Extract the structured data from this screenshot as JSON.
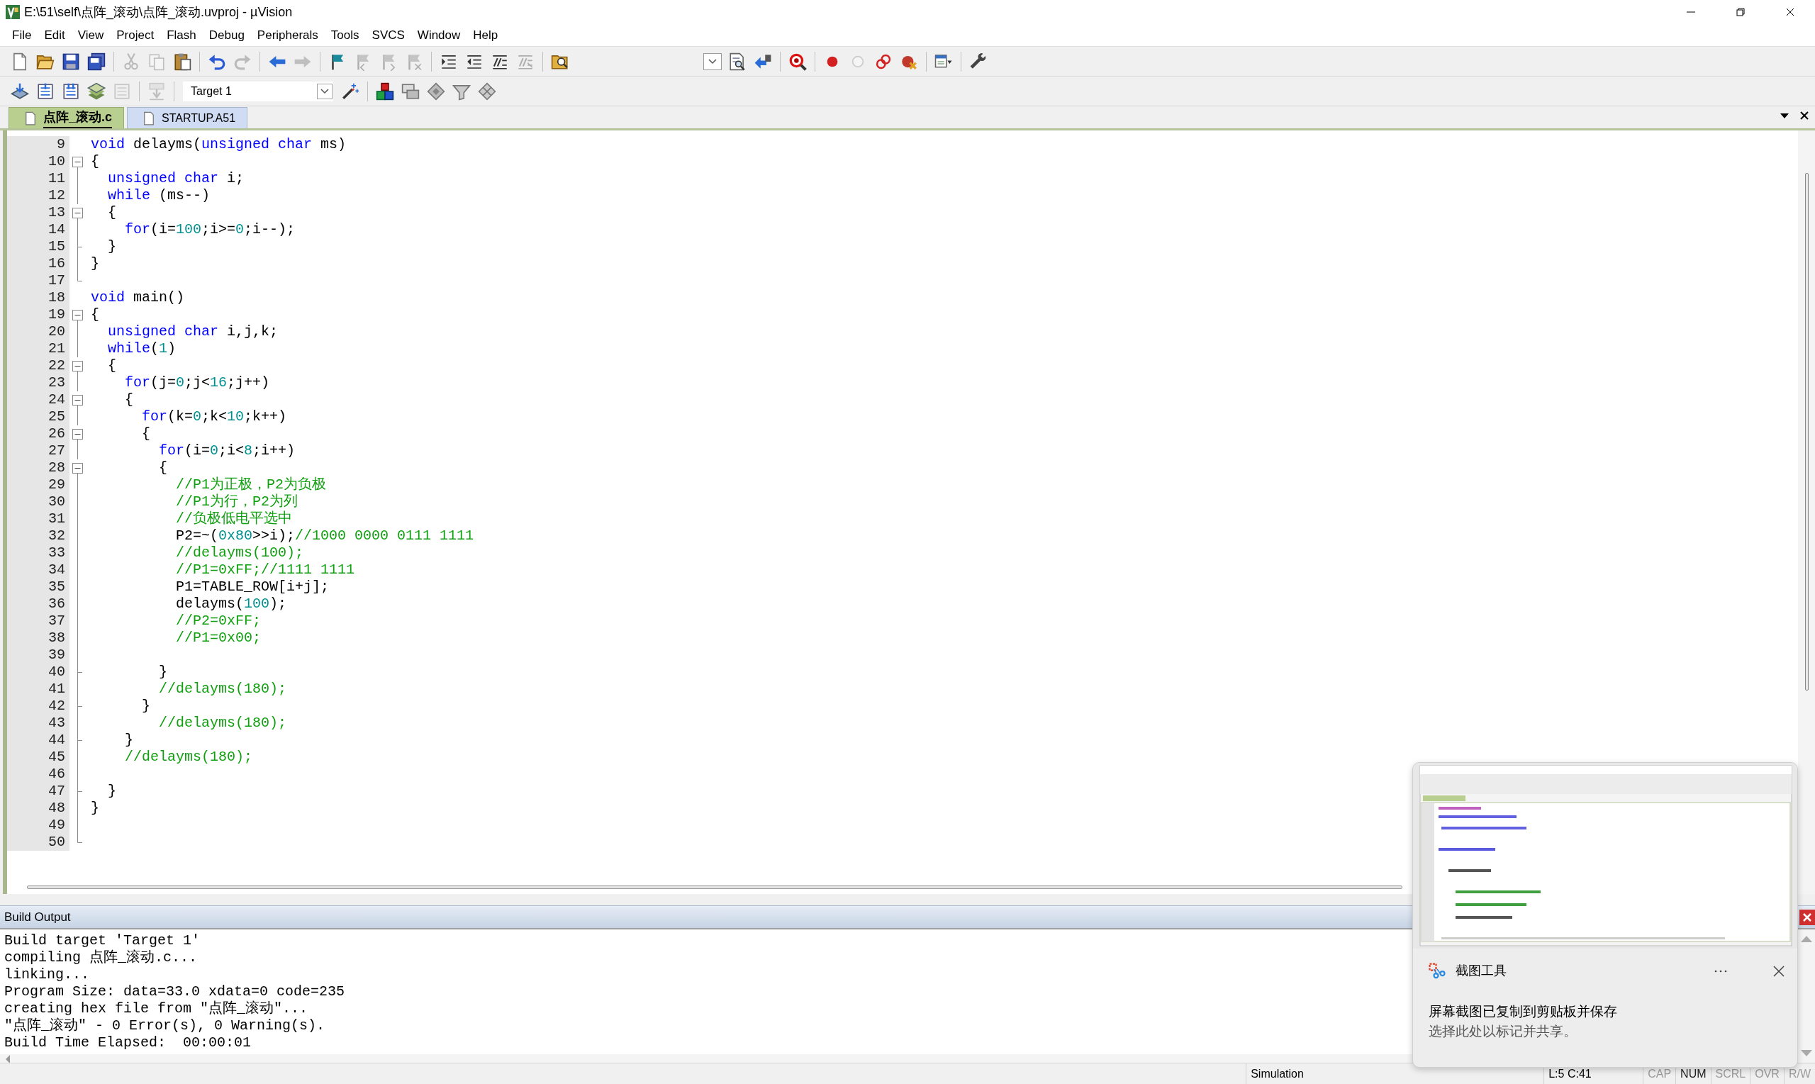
{
  "window": {
    "title": "E:\\51\\self\\点阵_滚动\\点阵_滚动.uvproj - µVision"
  },
  "menu": [
    "File",
    "Edit",
    "View",
    "Project",
    "Flash",
    "Debug",
    "Peripherals",
    "Tools",
    "SVCS",
    "Window",
    "Help"
  ],
  "toolbar_1": [
    {
      "kind": "new",
      "disabled": false
    },
    {
      "kind": "open",
      "disabled": false
    },
    {
      "kind": "save",
      "disabled": false
    },
    {
      "kind": "saveall",
      "disabled": false
    },
    {
      "kind": "separator"
    },
    {
      "kind": "cut",
      "disabled": true
    },
    {
      "kind": "copy",
      "disabled": true
    },
    {
      "kind": "paste",
      "disabled": false
    },
    {
      "kind": "separator"
    },
    {
      "kind": "undo",
      "disabled": false
    },
    {
      "kind": "redo",
      "disabled": true
    },
    {
      "kind": "separator"
    },
    {
      "kind": "back",
      "disabled": false
    },
    {
      "kind": "forward",
      "disabled": true
    },
    {
      "kind": "separator"
    },
    {
      "kind": "flag",
      "disabled": false
    },
    {
      "kind": "flagprev",
      "disabled": true
    },
    {
      "kind": "flagnext",
      "disabled": true
    },
    {
      "kind": "flagclear",
      "disabled": true
    },
    {
      "kind": "separator"
    },
    {
      "kind": "indent",
      "disabled": false
    },
    {
      "kind": "outdent",
      "disabled": false
    },
    {
      "kind": "comment",
      "disabled": false
    },
    {
      "kind": "uncomment",
      "disabled": true
    },
    {
      "kind": "separator"
    },
    {
      "kind": "findfiles",
      "disabled": false
    },
    {
      "kind": "spacer"
    },
    {
      "kind": "combo",
      "disabled": false
    },
    {
      "kind": "find",
      "disabled": false
    },
    {
      "kind": "findarrow",
      "disabled": false
    },
    {
      "kind": "separator"
    },
    {
      "kind": "debug",
      "disabled": false
    },
    {
      "kind": "separator"
    },
    {
      "kind": "breakpoint",
      "disabled": false
    },
    {
      "kind": "circle",
      "disabled": true
    },
    {
      "kind": "rings",
      "disabled": false
    },
    {
      "kind": "bpkill",
      "disabled": false
    },
    {
      "kind": "separator"
    },
    {
      "kind": "window",
      "disabled": false
    },
    {
      "kind": "separator"
    },
    {
      "kind": "wrench",
      "disabled": false
    }
  ],
  "toolbar_2": [
    {
      "kind": "translate",
      "disabled": false
    },
    {
      "kind": "build",
      "disabled": false
    },
    {
      "kind": "rebuild",
      "disabled": false
    },
    {
      "kind": "batch",
      "disabled": false
    },
    {
      "kind": "stop",
      "disabled": true
    },
    {
      "kind": "separator"
    },
    {
      "kind": "load",
      "disabled": true
    },
    {
      "kind": "separator"
    },
    {
      "kind": "target",
      "value": "Target 1"
    },
    {
      "kind": "wand",
      "disabled": false
    },
    {
      "kind": "separator"
    },
    {
      "kind": "components",
      "disabled": false
    },
    {
      "kind": "stack",
      "disabled": false
    },
    {
      "kind": "diamond",
      "disabled": false
    },
    {
      "kind": "funnel",
      "disabled": false
    },
    {
      "kind": "grid",
      "disabled": false
    }
  ],
  "tabs": [
    {
      "label": "点阵_滚动.c",
      "selected": true
    },
    {
      "label": "STARTUP.A51",
      "selected": false
    }
  ],
  "editor": {
    "lines": [
      {
        "number": "9",
        "kind": "plain",
        "tokens": [
          {
            "kind": "keyword",
            "text": "void"
          },
          {
            "kind": "plain",
            "text": " delayms("
          },
          {
            "kind": "keyword",
            "text": "unsigned char"
          },
          {
            "kind": "plain",
            "text": " ms)"
          }
        ]
      },
      {
        "number": "10",
        "kind": "box",
        "tokens": [
          {
            "kind": "plain",
            "text": "{"
          }
        ]
      },
      {
        "number": "11",
        "kind": "line",
        "tokens": [
          {
            "kind": "keyword",
            "text": "  unsigned char"
          },
          {
            "kind": "plain",
            "text": " i;"
          }
        ]
      },
      {
        "number": "12",
        "kind": "line",
        "tokens": [
          {
            "kind": "keyword",
            "text": "  while"
          },
          {
            "kind": "plain",
            "text": " (ms--)"
          }
        ]
      },
      {
        "number": "13",
        "kind": "box",
        "tokens": [
          {
            "kind": "plain",
            "text": "  {"
          }
        ]
      },
      {
        "number": "14",
        "kind": "line",
        "tokens": [
          {
            "kind": "keyword",
            "text": "    for"
          },
          {
            "kind": "plain",
            "text": "(i="
          },
          {
            "kind": "number",
            "text": "100"
          },
          {
            "kind": "plain",
            "text": ";i>="
          },
          {
            "kind": "number",
            "text": "0"
          },
          {
            "kind": "plain",
            "text": ";i--);"
          }
        ]
      },
      {
        "number": "15",
        "kind": "tick",
        "tokens": [
          {
            "kind": "plain",
            "text": "  }"
          }
        ]
      },
      {
        "number": "16",
        "kind": "line",
        "tokens": [
          {
            "kind": "plain",
            "text": "}"
          }
        ]
      },
      {
        "number": "17",
        "kind": "end"
      },
      {
        "number": "18",
        "kind": "plain",
        "tokens": [
          {
            "kind": "keyword",
            "text": "void"
          },
          {
            "kind": "plain",
            "text": " main()"
          }
        ]
      },
      {
        "number": "19",
        "kind": "box",
        "tokens": [
          {
            "kind": "plain",
            "text": "{"
          }
        ]
      },
      {
        "number": "20",
        "kind": "line",
        "tokens": [
          {
            "kind": "keyword",
            "text": "  unsigned char"
          },
          {
            "kind": "plain",
            "text": " i,j,k;"
          }
        ]
      },
      {
        "number": "21",
        "kind": "line",
        "tokens": [
          {
            "kind": "keyword",
            "text": "  while"
          },
          {
            "kind": "plain",
            "text": "("
          },
          {
            "kind": "number",
            "text": "1"
          },
          {
            "kind": "plain",
            "text": ")"
          }
        ]
      },
      {
        "number": "22",
        "kind": "box",
        "tokens": [
          {
            "kind": "plain",
            "text": "  {"
          }
        ]
      },
      {
        "number": "23",
        "kind": "line",
        "tokens": [
          {
            "kind": "keyword",
            "text": "    for"
          },
          {
            "kind": "plain",
            "text": "(j="
          },
          {
            "kind": "number",
            "text": "0"
          },
          {
            "kind": "plain",
            "text": ";j<"
          },
          {
            "kind": "number",
            "text": "16"
          },
          {
            "kind": "plain",
            "text": ";j++)"
          }
        ]
      },
      {
        "number": "24",
        "kind": "box",
        "tokens": [
          {
            "kind": "plain",
            "text": "    {"
          }
        ]
      },
      {
        "number": "25",
        "kind": "line",
        "tokens": [
          {
            "kind": "keyword",
            "text": "      for"
          },
          {
            "kind": "plain",
            "text": "(k="
          },
          {
            "kind": "number",
            "text": "0"
          },
          {
            "kind": "plain",
            "text": ";k<"
          },
          {
            "kind": "number",
            "text": "10"
          },
          {
            "kind": "plain",
            "text": ";k++)"
          }
        ]
      },
      {
        "number": "26",
        "kind": "box",
        "tokens": [
          {
            "kind": "plain",
            "text": "      {"
          }
        ]
      },
      {
        "number": "27",
        "kind": "line",
        "tokens": [
          {
            "kind": "keyword",
            "text": "        for"
          },
          {
            "kind": "plain",
            "text": "(i="
          },
          {
            "kind": "number",
            "text": "0"
          },
          {
            "kind": "plain",
            "text": ";i<"
          },
          {
            "kind": "number",
            "text": "8"
          },
          {
            "kind": "plain",
            "text": ";i++)"
          }
        ]
      },
      {
        "number": "28",
        "kind": "box",
        "tokens": [
          {
            "kind": "plain",
            "text": "        {"
          }
        ]
      },
      {
        "number": "29",
        "kind": "line",
        "tokens": [
          {
            "kind": "comment",
            "text": "          //P1为正极，P2为负极"
          }
        ]
      },
      {
        "number": "30",
        "kind": "line",
        "tokens": [
          {
            "kind": "comment",
            "text": "          //P1为行，P2为列"
          }
        ]
      },
      {
        "number": "31",
        "kind": "line",
        "tokens": [
          {
            "kind": "comment",
            "text": "          //负极低电平选中"
          }
        ]
      },
      {
        "number": "32",
        "kind": "line",
        "tokens": [
          {
            "kind": "plain",
            "text": "          P2=~("
          },
          {
            "kind": "number",
            "text": "0x80"
          },
          {
            "kind": "plain",
            "text": ">>i);"
          },
          {
            "kind": "comment",
            "text": "//1000 0000 0111 1111"
          }
        ]
      },
      {
        "number": "33",
        "kind": "line",
        "tokens": [
          {
            "kind": "comment",
            "text": "          //delayms(100);"
          }
        ]
      },
      {
        "number": "34",
        "kind": "line",
        "tokens": [
          {
            "kind": "comment",
            "text": "          //P1=0xFF;//1111 1111"
          }
        ]
      },
      {
        "number": "35",
        "kind": "line",
        "tokens": [
          {
            "kind": "plain",
            "text": "          P1=TABLE_ROW[i+j];"
          }
        ]
      },
      {
        "number": "36",
        "kind": "line",
        "tokens": [
          {
            "kind": "plain",
            "text": "          delayms("
          },
          {
            "kind": "number",
            "text": "100"
          },
          {
            "kind": "plain",
            "text": ");"
          }
        ]
      },
      {
        "number": "37",
        "kind": "line",
        "tokens": [
          {
            "kind": "comment",
            "text": "          //P2=0xFF;"
          }
        ]
      },
      {
        "number": "38",
        "kind": "line",
        "tokens": [
          {
            "kind": "comment",
            "text": "          //P1=0x00;"
          }
        ]
      },
      {
        "number": "39",
        "kind": "line"
      },
      {
        "number": "40",
        "kind": "tick",
        "tokens": [
          {
            "kind": "plain",
            "text": "        }"
          }
        ]
      },
      {
        "number": "41",
        "kind": "line",
        "tokens": [
          {
            "kind": "comment",
            "text": "        //delayms(180);"
          }
        ]
      },
      {
        "number": "42",
        "kind": "tick",
        "tokens": [
          {
            "kind": "plain",
            "text": "      }"
          }
        ]
      },
      {
        "number": "43",
        "kind": "line",
        "tokens": [
          {
            "kind": "comment",
            "text": "        //delayms(180);"
          }
        ]
      },
      {
        "number": "44",
        "kind": "tick",
        "tokens": [
          {
            "kind": "plain",
            "text": "    }"
          }
        ]
      },
      {
        "number": "45",
        "kind": "line",
        "tokens": [
          {
            "kind": "comment",
            "text": "    //delayms(180);"
          }
        ]
      },
      {
        "number": "46",
        "kind": "line"
      },
      {
        "number": "47",
        "kind": "tick",
        "tokens": [
          {
            "kind": "plain",
            "text": "  }"
          }
        ]
      },
      {
        "number": "48",
        "kind": "line",
        "tokens": [
          {
            "kind": "plain",
            "text": "}"
          }
        ]
      },
      {
        "number": "49",
        "kind": "line"
      },
      {
        "number": "50",
        "kind": "end"
      }
    ]
  },
  "build_output": {
    "title": "Build Output",
    "lines": [
      "Build target 'Target 1'",
      "compiling 点阵_滚动.c...",
      "linking...",
      "Program Size: data=33.0 xdata=0 code=235",
      "creating hex file from \"点阵_滚动\"...",
      "\"点阵_滚动\" - 0 Error(s), 0 Warning(s).",
      "Build Time Elapsed:  00:00:01"
    ]
  },
  "status_bar": {
    "mode": "Simulation",
    "position": "L:5 C:41",
    "indicators": [
      {
        "label": "CAP",
        "on": false
      },
      {
        "label": "NUM",
        "on": true
      },
      {
        "label": "SCRL",
        "on": false
      },
      {
        "label": "OVR",
        "on": false
      },
      {
        "label": "R/W",
        "on": false
      }
    ]
  },
  "notification": {
    "app": "截图工具",
    "message": "屏幕截图已复制到剪贴板并保存",
    "hint": "选择此处以标记并共享。"
  }
}
